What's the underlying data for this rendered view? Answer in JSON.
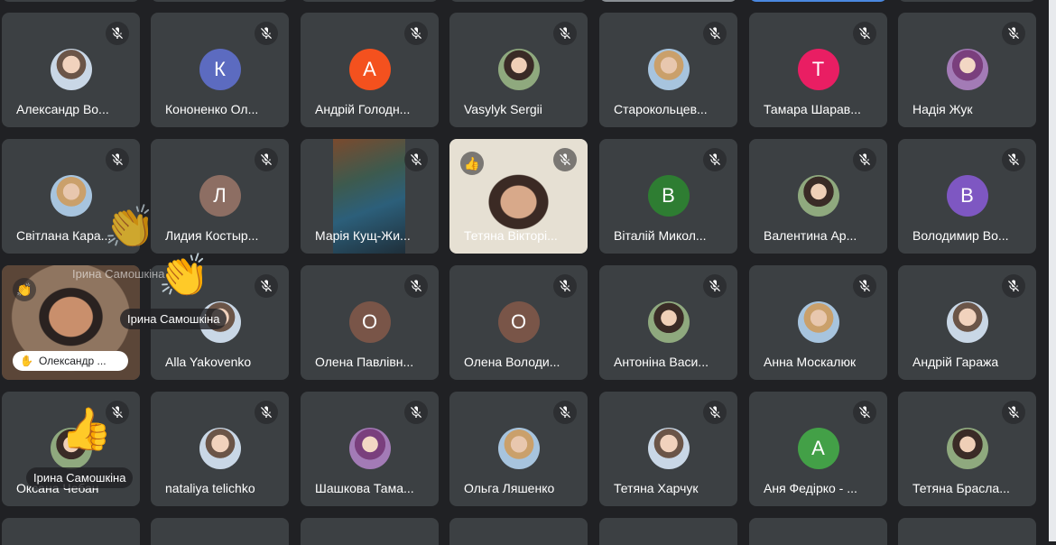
{
  "colors": {
    "background": "#202124",
    "tile": "#3c4043",
    "accent_k": "#5c6bc0",
    "accent_a": "#f4511e",
    "accent_t": "#e91e63",
    "accent_l": "#8d6e63",
    "accent_b_green": "#2e7d32",
    "accent_b_purple": "#7e57c2",
    "accent_o": "#795548"
  },
  "participants": [
    {
      "name": "Александр Во...",
      "avatar": "photo",
      "icon": "mic-off-icon"
    },
    {
      "name": "Кононенко Ол...",
      "avatar_letter": "К",
      "icon": "mic-off-icon"
    },
    {
      "name": "Андрій Голодн...",
      "avatar_letter": "А",
      "icon": "mic-off-icon"
    },
    {
      "name": "Vasylyk Sergii",
      "avatar": "photo",
      "icon": "mic-off-icon"
    },
    {
      "name": "Старокольцев...",
      "avatar": "photo",
      "icon": "mic-off-icon"
    },
    {
      "name": "Тамара Шарав...",
      "avatar_letter": "Т",
      "icon": "mic-off-icon"
    },
    {
      "name": "Надія Жук",
      "avatar": "photo",
      "icon": "mic-off-icon"
    },
    {
      "name": "Світлана Кара...",
      "avatar": "photo",
      "icon": "mic-off-icon"
    },
    {
      "name": "Лидия Костыр...",
      "avatar_letter": "Л",
      "icon": "mic-off-icon"
    },
    {
      "name": "Марія Кущ-Жи...",
      "avatar": "video",
      "icon": "mic-off-icon"
    },
    {
      "name": "Тетяна Вікторі...",
      "avatar": "video",
      "icon": "mic-off-icon"
    },
    {
      "name": "Віталій Микол...",
      "avatar_letter": "В",
      "icon": "mic-off-icon"
    },
    {
      "name": "Валентина Ар...",
      "avatar": "photo",
      "icon": "mic-off-icon"
    },
    {
      "name": "Володимир Во...",
      "avatar_letter": "В",
      "icon": "mic-off-icon"
    },
    {
      "name": "Олександр ...",
      "avatar": "video",
      "icon": "mic-off-icon"
    },
    {
      "name": "Alla Yakovenko",
      "avatar": "photo",
      "icon": "mic-off-icon"
    },
    {
      "name": "Олена Павлівн...",
      "avatar_letter": "О",
      "icon": "mic-off-icon"
    },
    {
      "name": "Олена Володи...",
      "avatar_letter": "О",
      "icon": "mic-off-icon"
    },
    {
      "name": "Антоніна Васи...",
      "avatar": "photo",
      "icon": "mic-off-icon"
    },
    {
      "name": "Анна Москалюк",
      "avatar": "photo",
      "icon": "mic-off-icon"
    },
    {
      "name": "Андрій Гаража",
      "avatar": "photo",
      "icon": "mic-off-icon"
    },
    {
      "name": "Оксана Чебан",
      "avatar": "photo",
      "icon": "mic-off-icon"
    },
    {
      "name": "nataliya telichko",
      "avatar": "photo",
      "icon": "mic-off-icon"
    },
    {
      "name": "Шашкова Тама...",
      "avatar": "photo",
      "icon": "mic-off-icon"
    },
    {
      "name": "Ольга Ляшенко",
      "avatar": "photo",
      "icon": "mic-off-icon"
    },
    {
      "name": "Тетяна Харчук",
      "avatar": "photo",
      "icon": "mic-off-icon"
    },
    {
      "name": "Аня Федірко - ...",
      "avatar_letter": "А",
      "icon": "mic-off-icon"
    },
    {
      "name": "Тетяна Брасла...",
      "avatar": "photo",
      "icon": "mic-off-icon"
    }
  ],
  "reactions": [
    {
      "sender": "Ірина Самошкіна",
      "emoji": "👏",
      "style": "faded"
    },
    {
      "sender": "Ірина Самошкіна",
      "emoji": "👏",
      "style": "normal"
    },
    {
      "sender": "Ірина Самошкіна",
      "emoji": "👍",
      "style": "normal"
    }
  ],
  "tile_badges": {
    "thumb": "👍",
    "hand": "✋"
  }
}
